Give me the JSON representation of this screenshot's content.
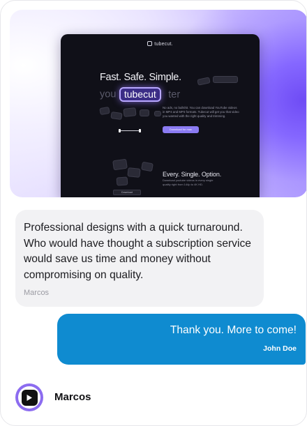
{
  "hero": {
    "brand": "tubecut.",
    "headline": "Fast. Safe. Simple.",
    "headline_prefix": "you",
    "headline_pill": "tubecut",
    "headline_suffix": "ter",
    "description": "No ads, no bullshit. You can download YouTube videos in MP4 and MP3 formats. Tubecut will get you that video you wanted with the right quality and trimming.",
    "cta_label": "Download for mac",
    "section2_title": "Every. Single. Option.",
    "section2_sub": "Download youtube videos in every single quality right from 144p to 4K HD.",
    "download_label": "Download"
  },
  "messages": [
    {
      "text": "Professional designs with a quick turnaround. Who would have thought a subscription service would save us time and money without compromising on quality.",
      "author": "Marcos"
    },
    {
      "text": "Thank you. More to come!",
      "author": "John Doe"
    }
  ],
  "footer": {
    "name": "Marcos",
    "avatar_icon": "play-icon"
  },
  "colors": {
    "accent_purple": "#7a5cff",
    "outgoing_bubble": "#0f8bd0",
    "incoming_bubble": "#f2f2f4"
  }
}
